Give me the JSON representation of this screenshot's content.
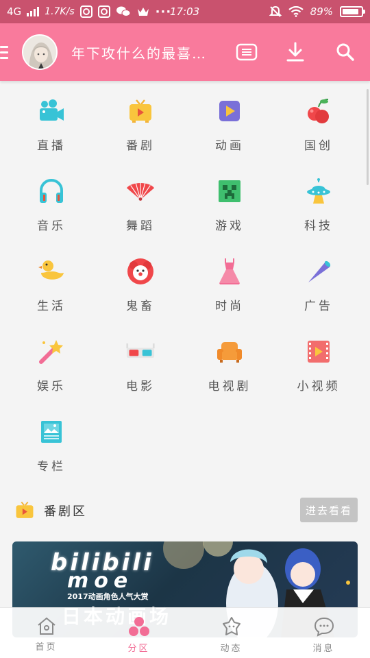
{
  "status_bar": {
    "network": "4G",
    "speed": "1.7K/s",
    "time": "17:03",
    "battery": "89%",
    "battery_level": 0.89
  },
  "header": {
    "title": "年下攻什么的最喜…"
  },
  "categories": [
    {
      "label": "直播",
      "icon": "live-camera-icon"
    },
    {
      "label": "番剧",
      "icon": "tv-icon"
    },
    {
      "label": "动画",
      "icon": "animation-play-icon"
    },
    {
      "label": "国创",
      "icon": "cherry-icon"
    },
    {
      "label": "音乐",
      "icon": "headphones-icon"
    },
    {
      "label": "舞蹈",
      "icon": "fan-icon"
    },
    {
      "label": "游戏",
      "icon": "creeper-icon"
    },
    {
      "label": "科技",
      "icon": "ufo-icon"
    },
    {
      "label": "生活",
      "icon": "duck-icon"
    },
    {
      "label": "鬼畜",
      "icon": "clown-icon"
    },
    {
      "label": "时尚",
      "icon": "dress-icon"
    },
    {
      "label": "广告",
      "icon": "telescope-icon"
    },
    {
      "label": "娱乐",
      "icon": "magic-wand-icon"
    },
    {
      "label": "电影",
      "icon": "3d-glasses-icon"
    },
    {
      "label": "电视剧",
      "icon": "sofa-icon"
    },
    {
      "label": "小视频",
      "icon": "film-icon"
    },
    {
      "label": "专栏",
      "icon": "article-icon"
    }
  ],
  "section": {
    "title": "番剧区",
    "more_label": "进去看看"
  },
  "banner": {
    "logo": "bilibili",
    "moe": "moe",
    "subtitle": "2017动画角色人气大赏",
    "headline": "日本动画场"
  },
  "bottom_nav": [
    {
      "label": "首页",
      "icon": "home-icon",
      "active": false
    },
    {
      "label": "分区",
      "icon": "category-icon",
      "active": true
    },
    {
      "label": "动态",
      "icon": "moments-icon",
      "active": false
    },
    {
      "label": "消息",
      "icon": "message-icon",
      "active": false
    }
  ],
  "colors": {
    "status_bar": "#c9526e",
    "header": "#f97a9c",
    "accent": "#f26d95"
  }
}
